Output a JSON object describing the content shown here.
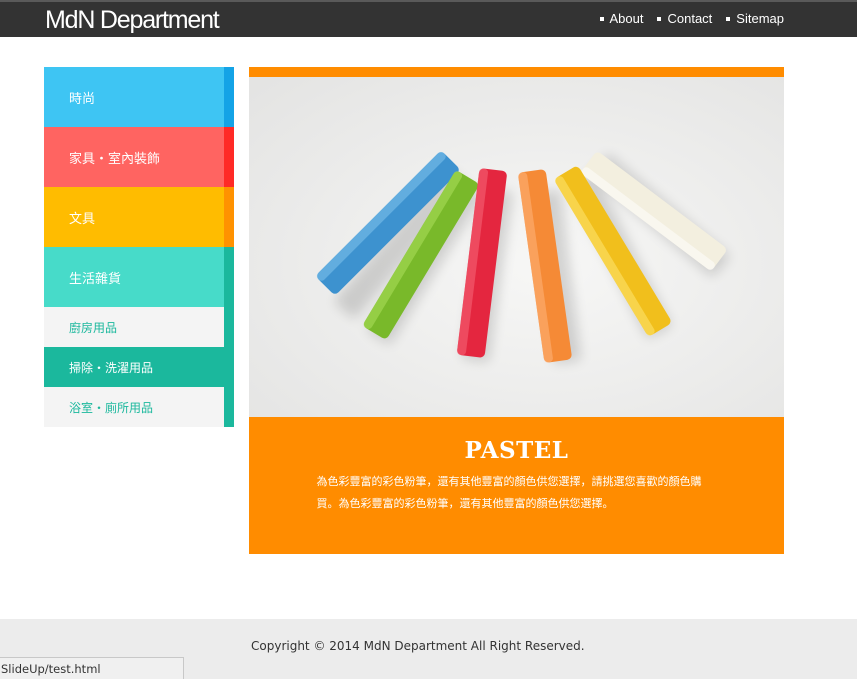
{
  "header": {
    "logo": "MdN Department",
    "nav": [
      {
        "label": "About"
      },
      {
        "label": "Contact"
      },
      {
        "label": "Sitemap"
      }
    ]
  },
  "sidebar": {
    "categories": [
      {
        "label": "時尚",
        "color": "#3ec5f3",
        "edge": "#14a3e6"
      },
      {
        "label": "家具・室內裝飾",
        "color": "#ff6461",
        "edge": "#ff2a26"
      },
      {
        "label": "文具",
        "color": "#ffbc00",
        "edge": "#ff9200"
      },
      {
        "label": "生活雜貨",
        "color": "#47dbc9",
        "edge": "#1bb89d"
      }
    ],
    "subitems": [
      {
        "label": "廚房用品",
        "active": false
      },
      {
        "label": "掃除・洗濯用品",
        "active": true
      },
      {
        "label": "浴室・廁所用品",
        "active": false
      }
    ]
  },
  "main": {
    "accent": "#ff8c00",
    "image_alt": "pastel-chalks",
    "title": "PASTEL",
    "description": "為色彩豐富的彩色粉筆，還有其他豐富的顏色供您選擇，請挑選您喜歡的顏色購買。為色彩豐富的彩色粉筆，還有其他豐富的顏色供您選擇。"
  },
  "footer": {
    "copyright": "Copyright © 2014 MdN Department All Right Reserved."
  },
  "statusbar": {
    "text": "SlideUp/test.html"
  }
}
